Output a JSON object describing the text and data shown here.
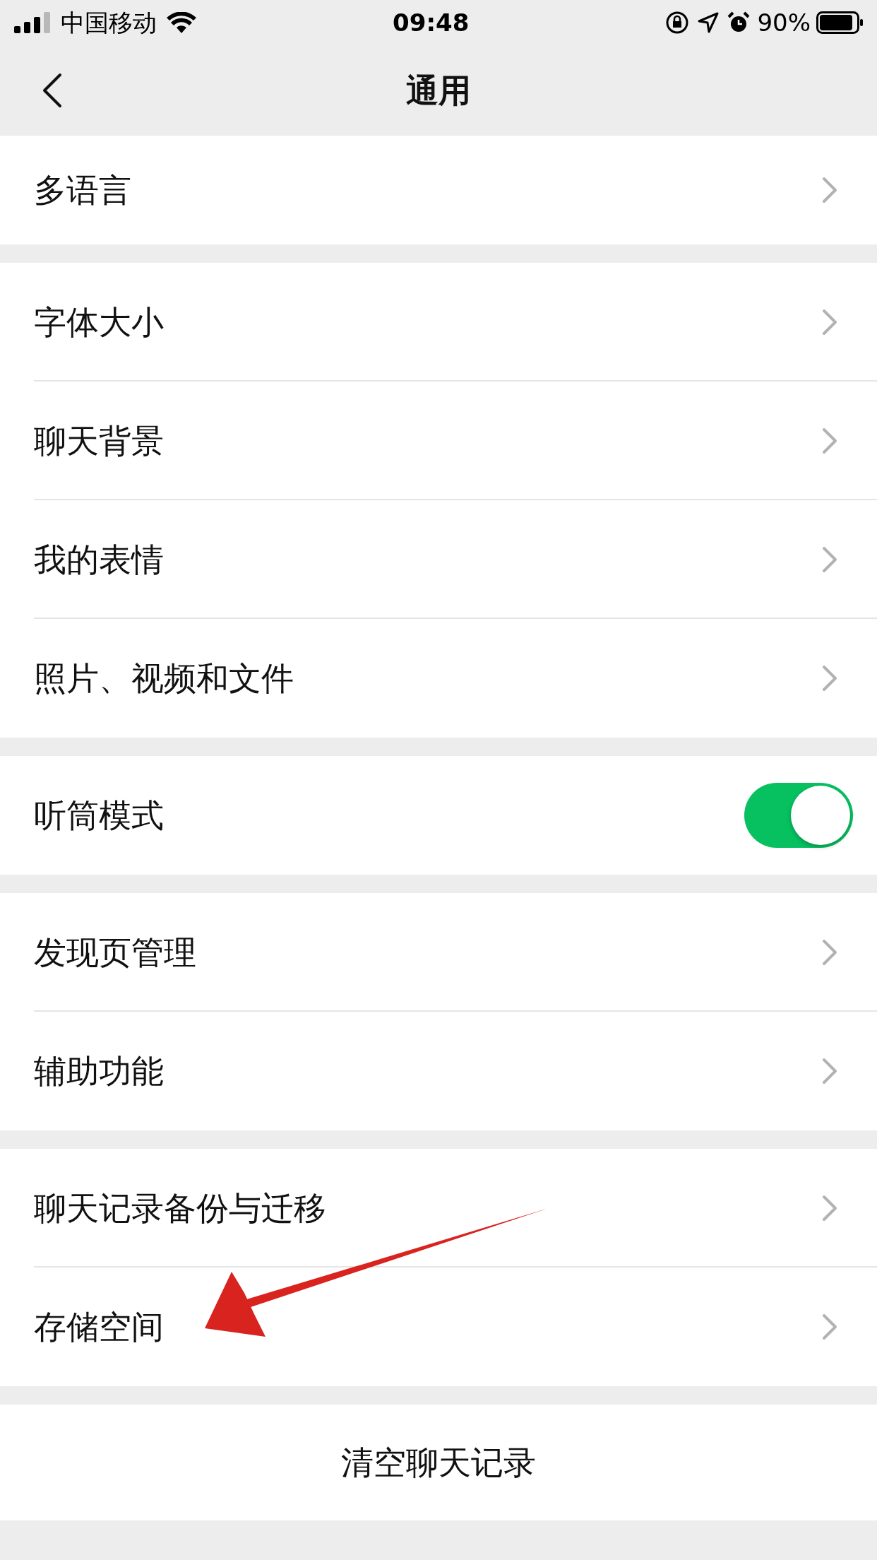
{
  "status_bar": {
    "carrier": "中国移动",
    "time": "09:48",
    "battery": "90%"
  },
  "nav": {
    "title": "通用"
  },
  "groups": [
    {
      "items": [
        {
          "kind": "link",
          "label": "多语言"
        }
      ]
    },
    {
      "items": [
        {
          "kind": "link",
          "label": "字体大小"
        },
        {
          "kind": "link",
          "label": "聊天背景"
        },
        {
          "kind": "link",
          "label": "我的表情"
        },
        {
          "kind": "link",
          "label": "照片、视频和文件"
        }
      ]
    },
    {
      "items": [
        {
          "kind": "toggle",
          "label": "听筒模式",
          "on": true
        }
      ]
    },
    {
      "items": [
        {
          "kind": "link",
          "label": "发现页管理"
        },
        {
          "kind": "link",
          "label": "辅助功能"
        }
      ]
    },
    {
      "items": [
        {
          "kind": "link",
          "label": "聊天记录备份与迁移"
        },
        {
          "kind": "link",
          "label": "存储空间"
        }
      ]
    }
  ],
  "clear_button": "清空聊天记录"
}
